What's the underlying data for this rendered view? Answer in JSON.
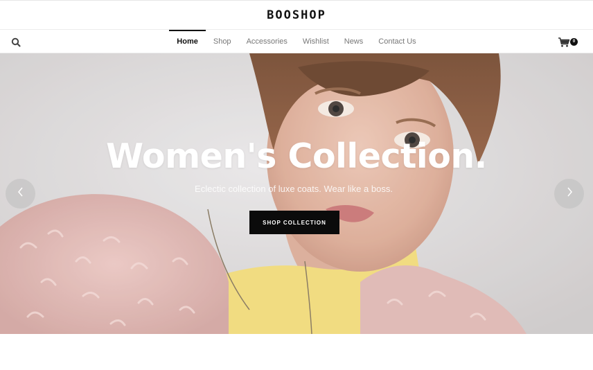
{
  "header": {
    "logo_text": "BOOSHOP"
  },
  "nav": {
    "items": [
      {
        "label": "Home",
        "active": true
      },
      {
        "label": "Shop",
        "active": false
      },
      {
        "label": "Accessories",
        "active": false
      },
      {
        "label": "Wishlist",
        "active": false
      },
      {
        "label": "News",
        "active": false
      },
      {
        "label": "Contact Us",
        "active": false
      }
    ],
    "search_icon": "search-icon",
    "cart_icon": "cart-icon",
    "cart_count": "0"
  },
  "hero": {
    "title": "Women's Collection.",
    "subtitle": "Eclectic collection of luxe coats. Wear like a boss.",
    "cta_label": "SHOP COLLECTION",
    "prev_icon": "chevron-left-icon",
    "next_icon": "chevron-right-icon"
  },
  "colors": {
    "text_dark": "#111111",
    "nav_text": "#777777",
    "cta_background": "#0b0b0b",
    "hero_background": "#d6d3d2"
  }
}
